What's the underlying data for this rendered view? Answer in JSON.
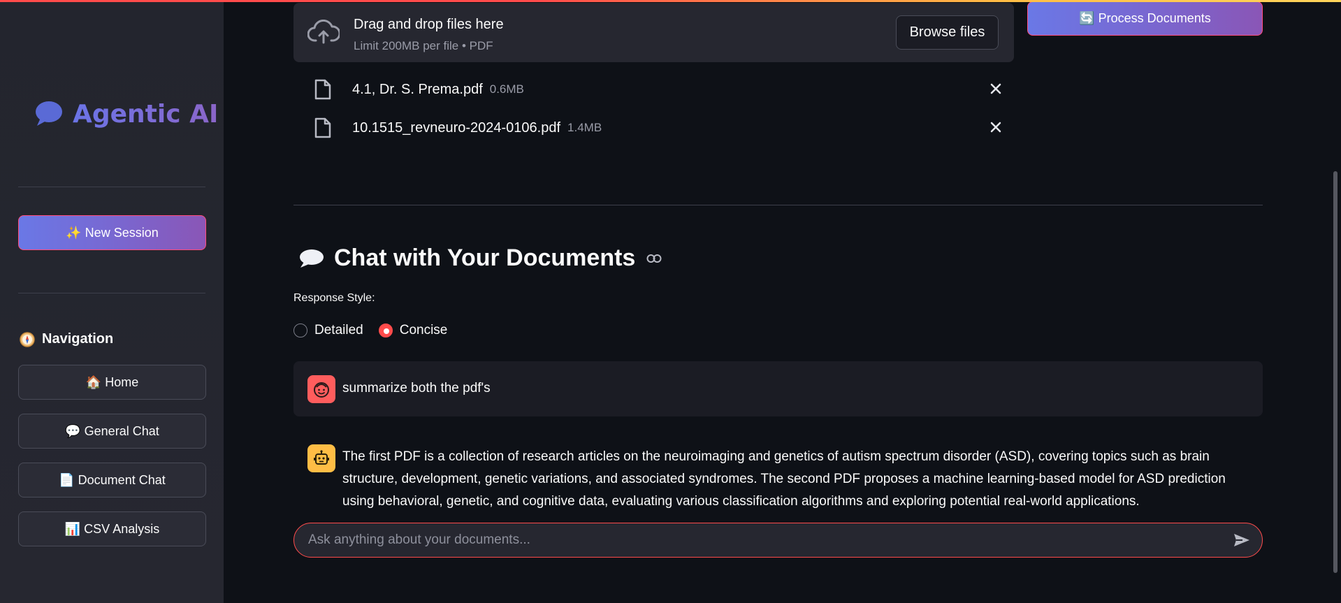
{
  "sidebar": {
    "brand": "Agentic AI",
    "new_session": "✨ New Session",
    "nav_title": "Navigation",
    "nav": [
      {
        "label": "🏠 Home"
      },
      {
        "label": "💬 General Chat"
      },
      {
        "label": "📄 Document Chat"
      },
      {
        "label": "📊 CSV Analysis"
      }
    ]
  },
  "uploader": {
    "title": "Drag and drop files here",
    "subtitle": "Limit 200MB per file • PDF",
    "browse": "Browse files",
    "files": [
      {
        "name": "4.1, Dr. S. Prema.pdf",
        "size": "0.6MB"
      },
      {
        "name": "10.1515_revneuro-2024-0106.pdf",
        "size": "1.4MB"
      }
    ]
  },
  "process_button": "🔄 Process Documents",
  "chat": {
    "title": "Chat with Your Documents",
    "response_label": "Response Style:",
    "options": [
      {
        "label": "Detailed",
        "selected": false
      },
      {
        "label": "Concise",
        "selected": true
      }
    ],
    "messages": [
      {
        "role": "user",
        "text": "summarize both the pdf's"
      },
      {
        "role": "assistant",
        "text": "The first PDF is a collection of research articles on the neuroimaging and genetics of autism spectrum disorder (ASD), covering topics such as brain structure, development, genetic variations, and associated syndromes. The second PDF proposes a machine learning-based model for ASD prediction using behavioral, genetic, and cognitive data, evaluating various classification algorithms and exploring potential real-world applications."
      }
    ],
    "input_placeholder": "Ask anything about your documents..."
  },
  "colors": {
    "accent": "#ff4b4b",
    "brand_gradient_start": "#6a78e6",
    "brand_gradient_end": "#8a56b6",
    "bot_avatar": "#ffbd45",
    "user_avatar": "#ff5d5d"
  }
}
